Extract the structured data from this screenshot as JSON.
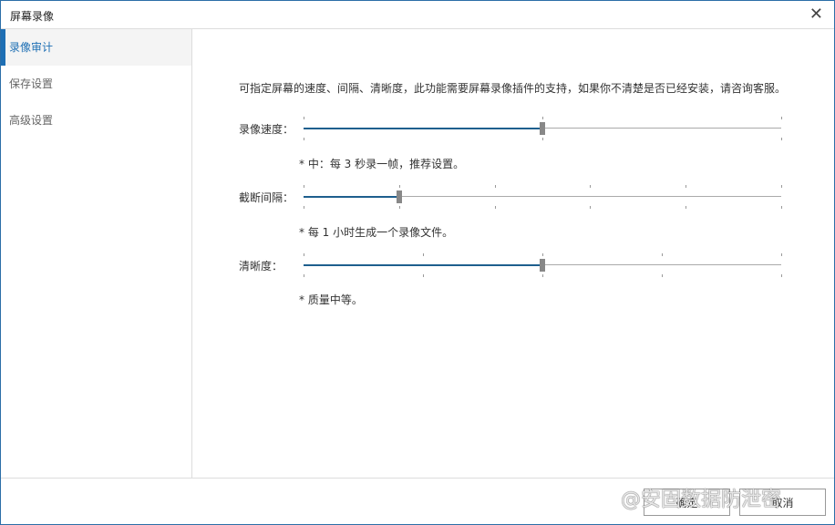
{
  "window": {
    "title": "屏幕录像",
    "close_icon": "close-icon"
  },
  "sidebar": {
    "items": [
      {
        "label": "录像审计",
        "active": true
      },
      {
        "label": "保存设置"
      },
      {
        "label": "高级设置"
      }
    ]
  },
  "main": {
    "description": "可指定屏幕的速度、间隔、清晰度，此功能需要屏幕录像插件的支持，如果你不清楚是否已经安装，请咨询客服。",
    "sliders": [
      {
        "label": "录像速度：",
        "value": 0.5,
        "ticks": 3,
        "hint": "* 中：每 3 秒录一帧，推荐设置。"
      },
      {
        "label": "截断间隔：",
        "value": 0.2,
        "ticks": 6,
        "hint": "* 每 1 小时生成一个录像文件。"
      },
      {
        "label": "清晰度：",
        "value": 0.5,
        "ticks": 5,
        "hint": "* 质量中等。"
      }
    ]
  },
  "footer": {
    "ok_label": "确定",
    "cancel_label": "取消"
  },
  "watermark": "@安固数据防泄密",
  "colors": {
    "accent": "#1e6fb4"
  }
}
